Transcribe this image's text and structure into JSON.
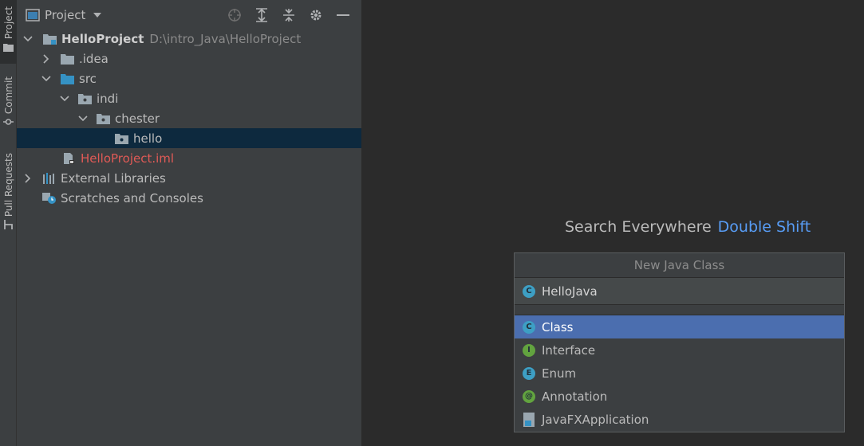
{
  "tool_strip": {
    "tabs": [
      {
        "label": "Project",
        "icon": "folder-icon",
        "active": true
      },
      {
        "label": "Commit",
        "icon": "commit-icon",
        "active": false
      },
      {
        "label": "Pull Requests",
        "icon": "pull-request-icon",
        "active": false
      }
    ]
  },
  "project_panel": {
    "title": "Project",
    "dropdown_icon": "caret-down-icon",
    "toolbar_icons": [
      "locate-icon",
      "expand-all-icon",
      "collapse-all-icon",
      "gear-icon",
      "minimize-icon"
    ],
    "tree": [
      {
        "label": "HelloProject",
        "path": "D:\\intro_Java\\HelloProject",
        "expanded": true,
        "icon": "module-folder-icon",
        "style": "bold"
      },
      {
        "label": ".idea",
        "expanded": false,
        "icon": "folder-icon",
        "style": "normal"
      },
      {
        "label": "src",
        "expanded": true,
        "icon": "source-folder-icon",
        "style": "normal"
      },
      {
        "label": "indi",
        "expanded": true,
        "icon": "package-icon",
        "style": "normal"
      },
      {
        "label": "chester",
        "expanded": true,
        "icon": "package-icon",
        "style": "normal"
      },
      {
        "label": "hello",
        "icon": "package-icon",
        "style": "normal",
        "selected": true
      },
      {
        "label": "HelloProject.iml",
        "icon": "iml-file-icon",
        "style": "red"
      },
      {
        "label": "External Libraries",
        "expanded": false,
        "icon": "libraries-icon",
        "style": "normal"
      },
      {
        "label": "Scratches and Consoles",
        "icon": "scratches-icon",
        "style": "normal"
      }
    ]
  },
  "editor": {
    "hint_text": "Search Everywhere",
    "hint_shortcut": "Double Shift"
  },
  "new_class_popup": {
    "title": "New Java Class",
    "name_value": "HelloJava",
    "name_icon": "class-icon",
    "kinds": [
      {
        "label": "Class",
        "badge": "C",
        "color": "#3d9fc4",
        "selected": true
      },
      {
        "label": "Interface",
        "badge": "I",
        "color": "#62a33f",
        "selected": false
      },
      {
        "label": "Enum",
        "badge": "E",
        "color": "#3d9fc4",
        "selected": false
      },
      {
        "label": "Annotation",
        "badge": "@",
        "color": "#62a33f",
        "selected": false
      },
      {
        "label": "JavaFXApplication",
        "badge": "",
        "color": "#6897bb",
        "selected": false
      }
    ]
  },
  "colors": {
    "panel_bg": "#3c3f41",
    "editor_bg": "#2b2b2b",
    "selection": "#0d293e",
    "popup_selection": "#4b6eaf",
    "link_blue": "#589df6",
    "iml_red": "#e05a56"
  }
}
